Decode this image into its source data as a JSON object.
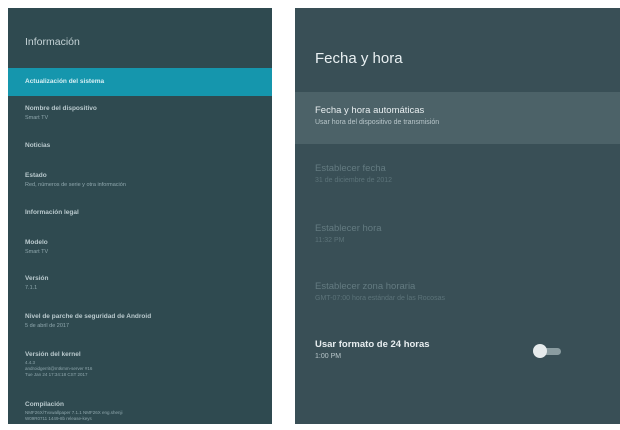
{
  "left": {
    "title": "Información",
    "items": [
      {
        "label": "Actualización del sistema",
        "sub": ""
      },
      {
        "label": "Nombre del dispositivo",
        "sub": "Smart TV"
      },
      {
        "label": "Noticias",
        "sub": ""
      },
      {
        "label": "Estado",
        "sub": "Red, números de serie y otra información"
      },
      {
        "label": "Información legal",
        "sub": ""
      },
      {
        "label": "Modelo",
        "sub": "Smart TV"
      },
      {
        "label": "Versión",
        "sub": "7.1.1"
      },
      {
        "label": "Nivel de parche de seguridad de Android",
        "sub": "5 de abril de 2017"
      },
      {
        "label": "Versión del kernel",
        "sub": "4.4.3\nandroidgerrit@mtkmm-server #16\nTue Jan 24 17:34:18 CST 2017"
      },
      {
        "label": "Compilación",
        "sub": "NMF26X/Tvxwallpaper 7.1.1 NMF26X eng.shenji\nW09R0711 1449-8b release-keys"
      }
    ]
  },
  "right": {
    "title": "Fecha y hora",
    "items": [
      {
        "label": "Fecha y hora automáticas",
        "sub": "Usar hora del dispositivo de transmisión"
      },
      {
        "label": "Establecer fecha",
        "sub": "31 de diciembre de 2012"
      },
      {
        "label": "Establecer hora",
        "sub": "11:32 PM"
      },
      {
        "label": "Establecer zona horaria",
        "sub": "GMT-07:00 hora estándar de las Rocosas"
      },
      {
        "label": "Usar formato de 24 horas",
        "sub": "1:00 PM"
      }
    ],
    "toggle_24h": false
  }
}
